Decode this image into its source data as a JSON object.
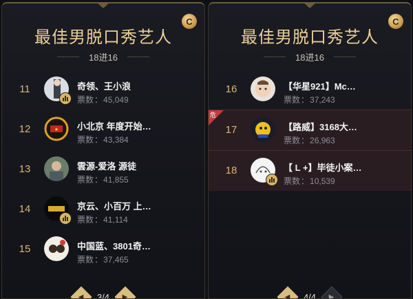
{
  "panels": [
    {
      "title": "最佳男脱口秀艺人",
      "round": "18进16",
      "coin": "C",
      "pager": "3/4",
      "rows": [
        {
          "rank": "11",
          "name": "奇领、王小浪",
          "votes_label": "票数",
          "votes": "45,049"
        },
        {
          "rank": "12",
          "name": "小北京 年度开始…",
          "votes_label": "票数",
          "votes": "43,384"
        },
        {
          "rank": "13",
          "name": "雲源-爱洛 源徒",
          "votes_label": "票数",
          "votes": "41,855"
        },
        {
          "rank": "14",
          "name": "京云、小百万 上…",
          "votes_label": "票数",
          "votes": "41,114"
        },
        {
          "rank": "15",
          "name": "中国蓝、3801奇…",
          "votes_label": "票数",
          "votes": "37,465"
        }
      ]
    },
    {
      "title": "最佳男脱口秀艺人",
      "round": "18进16",
      "coin": "C",
      "pager": "4/4",
      "flag": "危",
      "rows": [
        {
          "rank": "16",
          "name": "【华星921】Mc…",
          "votes_label": "票数",
          "votes": "37,243"
        },
        {
          "rank": "17",
          "name": "【路威】3168大…",
          "votes_label": "票数",
          "votes": "26,963"
        },
        {
          "rank": "18",
          "name": "【 L +】毕徒小案…",
          "votes_label": "票数",
          "votes": "10,539"
        }
      ]
    }
  ],
  "colors": {
    "gold": "#d9b478",
    "danger": "#c23a3e",
    "highlight": "#2a1d22"
  }
}
